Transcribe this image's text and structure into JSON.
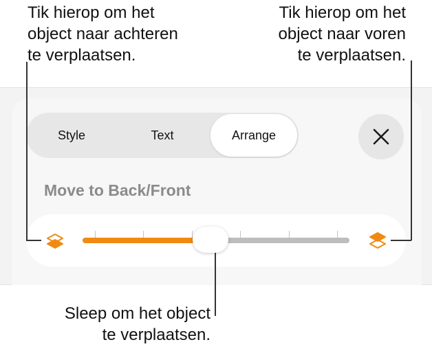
{
  "callouts": {
    "back": [
      "Tik hierop om het",
      "object naar achteren",
      "te verplaatsen."
    ],
    "front": [
      "Tik hierop om het",
      "object naar voren",
      "te verplaatsen."
    ],
    "drag": [
      "Sleep om het object",
      "te verplaatsen."
    ]
  },
  "tabs": [
    {
      "label": "Style"
    },
    {
      "label": "Text"
    },
    {
      "label": "Arrange",
      "selected": true
    }
  ],
  "close_icon": "close-icon",
  "arrange": {
    "section_title": "Move to Back/Front",
    "slider": {
      "value": 0.48,
      "tick_count": 6,
      "back_icon": "layers-back-icon",
      "front_icon": "layers-front-icon"
    }
  },
  "colors": {
    "accent": "#f08a12",
    "track_inactive": "#bdbdbd",
    "section_title": "#8b8b8b",
    "panel_bg": "#f7f7f7",
    "segmented_bg": "#e7e7e7"
  }
}
